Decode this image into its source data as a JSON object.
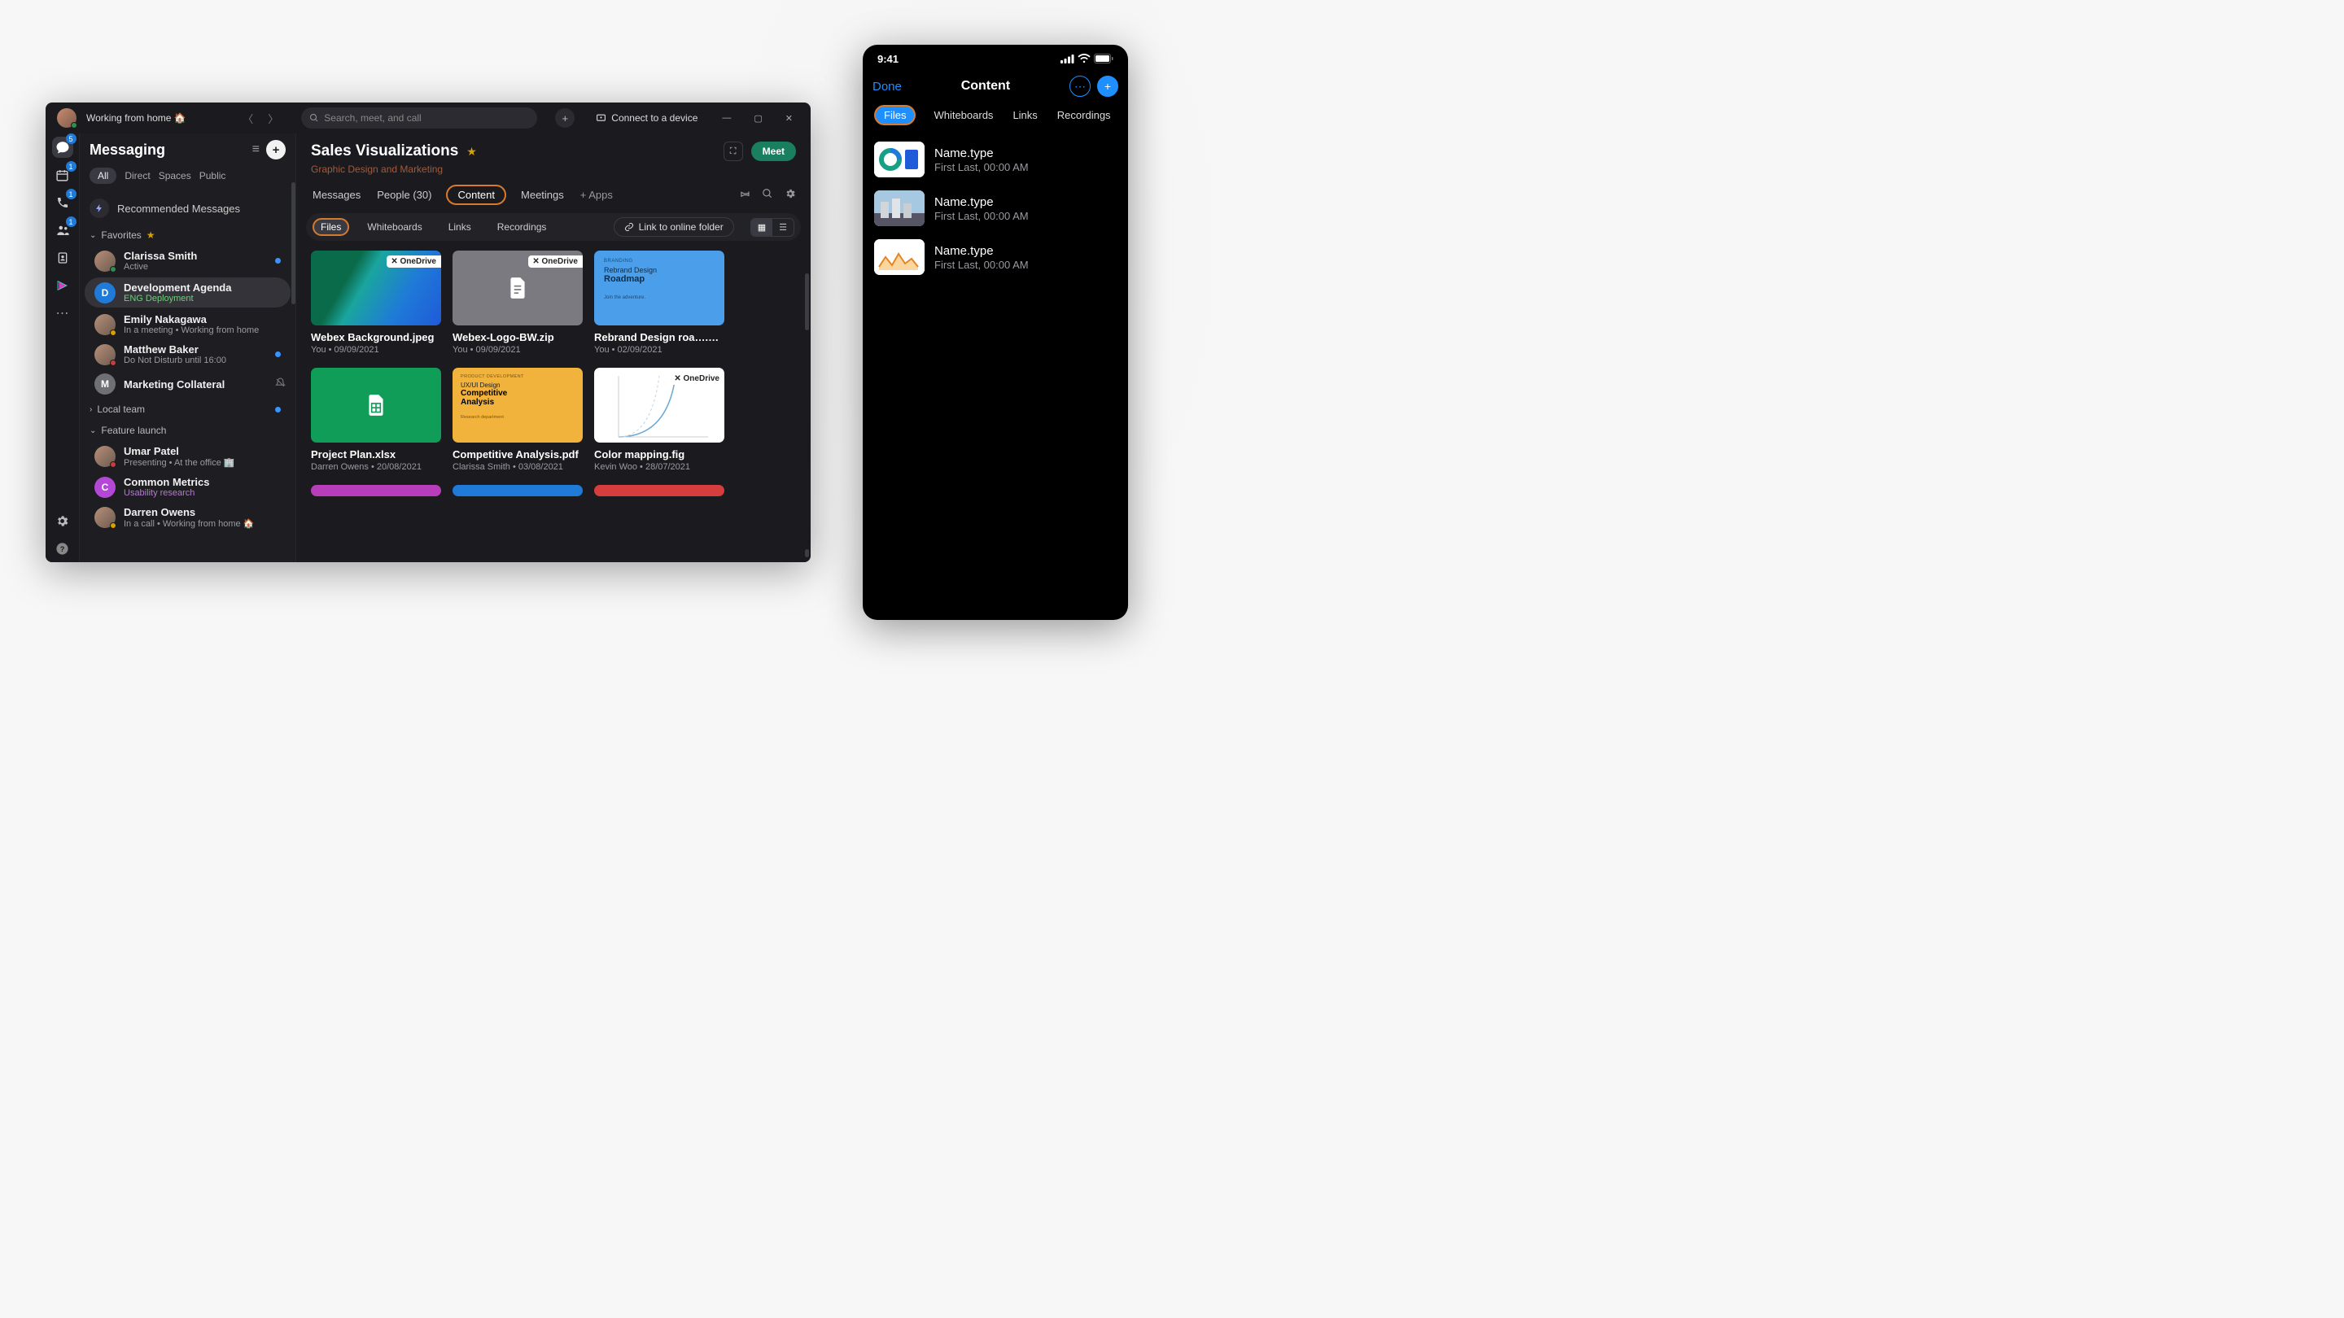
{
  "desktop": {
    "status_text": "Working from home 🏠",
    "search_placeholder": "Search, meet, and call",
    "connect_label": "Connect to a device",
    "rail": {
      "chat_badge": "5",
      "cal_badge": "1",
      "call_badge": "1",
      "teams_badge": "1"
    },
    "sidebar": {
      "title": "Messaging",
      "filters": {
        "all": "All",
        "direct": "Direct",
        "spaces": "Spaces",
        "public": "Public"
      },
      "recommended": "Recommended Messages",
      "sections": {
        "favorites": {
          "label": "Favorites",
          "items": [
            {
              "name": "Clarissa Smith",
              "sub": "Active",
              "presence": "green",
              "dot": true
            },
            {
              "name": "Development Agenda",
              "sub": "ENG Deployment",
              "initial": "D",
              "color": "#1f7ad8",
              "selected": true,
              "sub_class": "green"
            },
            {
              "name": "Emily Nakagawa",
              "sub": "In a meeting  •  Working from home",
              "presence": "yellow"
            },
            {
              "name": "Matthew Baker",
              "sub": "Do Not Disturb until 16:00",
              "presence": "red",
              "dot": true
            },
            {
              "name": "Marketing Collateral",
              "sub": "",
              "initial": "M",
              "color": "#6f6f76",
              "muted": true
            }
          ]
        },
        "local": {
          "label": "Local team",
          "has_dot": true
        },
        "feature": {
          "label": "Feature launch",
          "items": [
            {
              "name": "Umar Patel",
              "sub": "Presenting  •  At the office 🏢",
              "presence": "red"
            },
            {
              "name": "Common Metrics",
              "sub": "Usability research",
              "initial": "C",
              "color": "#b347d6",
              "sub_class": "accent"
            },
            {
              "name": "Darren Owens",
              "sub": "In a call  •  Working from home 🏠",
              "presence": "yellow"
            }
          ]
        }
      }
    },
    "main": {
      "title": "Sales Visualizations",
      "subtitle": "Graphic Design and Marketing",
      "meet": "Meet",
      "tabs": {
        "messages": "Messages",
        "people": "People (30)",
        "content": "Content",
        "meetings": "Meetings",
        "apps": "+   Apps"
      },
      "subtabs": {
        "files": "Files",
        "whiteboards": "Whiteboards",
        "links": "Links",
        "recordings": "Recordings"
      },
      "link_folder": "Link to online folder",
      "onedrive_badge": "OneDrive",
      "files": [
        {
          "name": "Webex Background.jpeg",
          "meta": "You  •  09/09/2021",
          "od": true,
          "thumb": "gradient-gb"
        },
        {
          "name": "Webex-Logo-BW.zip",
          "meta": "You  •  09/09/2021",
          "od": true,
          "thumb": "gray-doc"
        },
        {
          "name": "Rebrand Design roa….ppt",
          "meta": "You  •  02/09/2021",
          "od": false,
          "thumb": "blue-slide",
          "slide": {
            "kicker": "BRANDING",
            "t1": "Rebrand Design",
            "t2": "Roadmap",
            "foot": "Join the adventure."
          }
        },
        {
          "name": "Project Plan.xlsx",
          "meta": "Darren Owens  •  20/08/2021",
          "od": false,
          "thumb": "green-sheet"
        },
        {
          "name": "Competitive Analysis.pdf",
          "meta": "Clarissa Smith  •  03/08/2021",
          "od": false,
          "thumb": "yellow-slide",
          "slide": {
            "kicker": "PRODUCT DEVELOPMENT",
            "t1": "UX/UI Design",
            "t2": "Competitive",
            "t3": "Analysis",
            "foot": "Research department"
          }
        },
        {
          "name": "Color mapping.fig",
          "meta": "Kevin Woo  •  28/07/2021",
          "od": true,
          "thumb": "white-curve"
        }
      ],
      "strips": [
        "#b83dbb",
        "#1f7ad8",
        "#d63d3d"
      ]
    }
  },
  "mobile": {
    "time": "9:41",
    "done": "Done",
    "title": "Content",
    "tabs": {
      "files": "Files",
      "whiteboards": "Whiteboards",
      "links": "Links",
      "recordings": "Recordings"
    },
    "rows": [
      {
        "name": "Name.type",
        "sub": "First Last, 00:00 AM",
        "thumb": "donut"
      },
      {
        "name": "Name.type",
        "sub": "First Last, 00:00 AM",
        "thumb": "photo"
      },
      {
        "name": "Name.type",
        "sub": "First Last, 00:00 AM",
        "thumb": "chart"
      }
    ]
  }
}
